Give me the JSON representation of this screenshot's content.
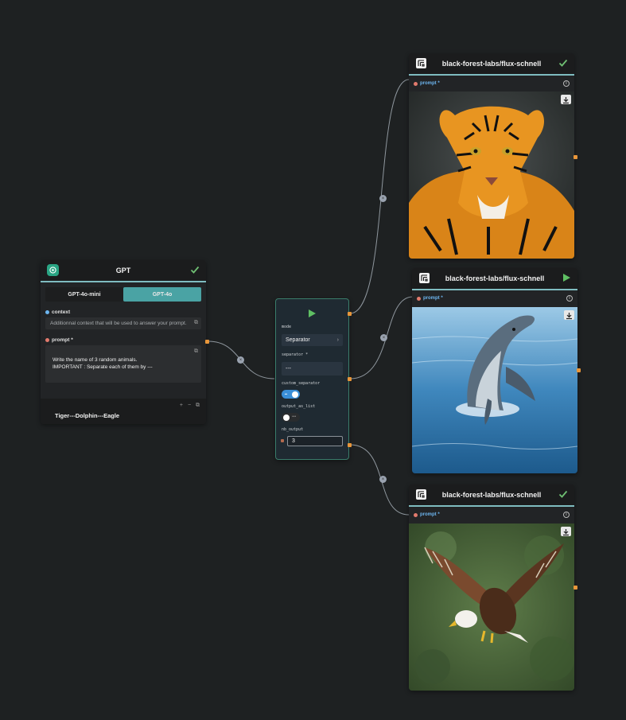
{
  "gpt_node": {
    "title": "GPT",
    "models": [
      "GPT-4o-mini",
      "GPT-4o"
    ],
    "selected_model": "GPT-4o",
    "context_label": "context",
    "context_placeholder": "Additionnal context that will be used to answer your prompt.",
    "prompt_label": "prompt *",
    "prompt_value": "Write the name of 3 random animals.\nIMPORTANT : Separate each of them by ---",
    "footer_icons": "+ − ⧉",
    "output": "Tiger---Dolphin---Eagle",
    "status": "done"
  },
  "separator_node": {
    "mode_label": "mode",
    "mode_value": "Separator",
    "separator_label": "separator *",
    "separator_value": "---",
    "custom_separator_label": "custom_separator",
    "custom_separator_on": true,
    "output_as_list_label": "output_as_list",
    "output_as_list_on": false,
    "nb_output_label": "nb_output",
    "nb_output_value": "3"
  },
  "flux_nodes": [
    {
      "title": "black-forest-labs/flux-schnell",
      "prompt_label": "prompt *",
      "status": "done",
      "image": "tiger"
    },
    {
      "title": "black-forest-labs/flux-schnell",
      "prompt_label": "prompt *",
      "status": "run",
      "image": "dolphin"
    },
    {
      "title": "black-forest-labs/flux-schnell",
      "prompt_label": "prompt *",
      "status": "done",
      "image": "eagle"
    }
  ],
  "colors": {
    "background": "#1e2122",
    "accent": "#4aa3a4",
    "check": "#6fbf73",
    "port": "#e8963a",
    "prompt_label": "#6db6f0"
  },
  "icons": [
    "gpt-logo-icon",
    "check-icon",
    "external-link-icon",
    "play-icon",
    "flux-logo-icon",
    "info-icon",
    "download-icon",
    "remove-edge-icon"
  ]
}
